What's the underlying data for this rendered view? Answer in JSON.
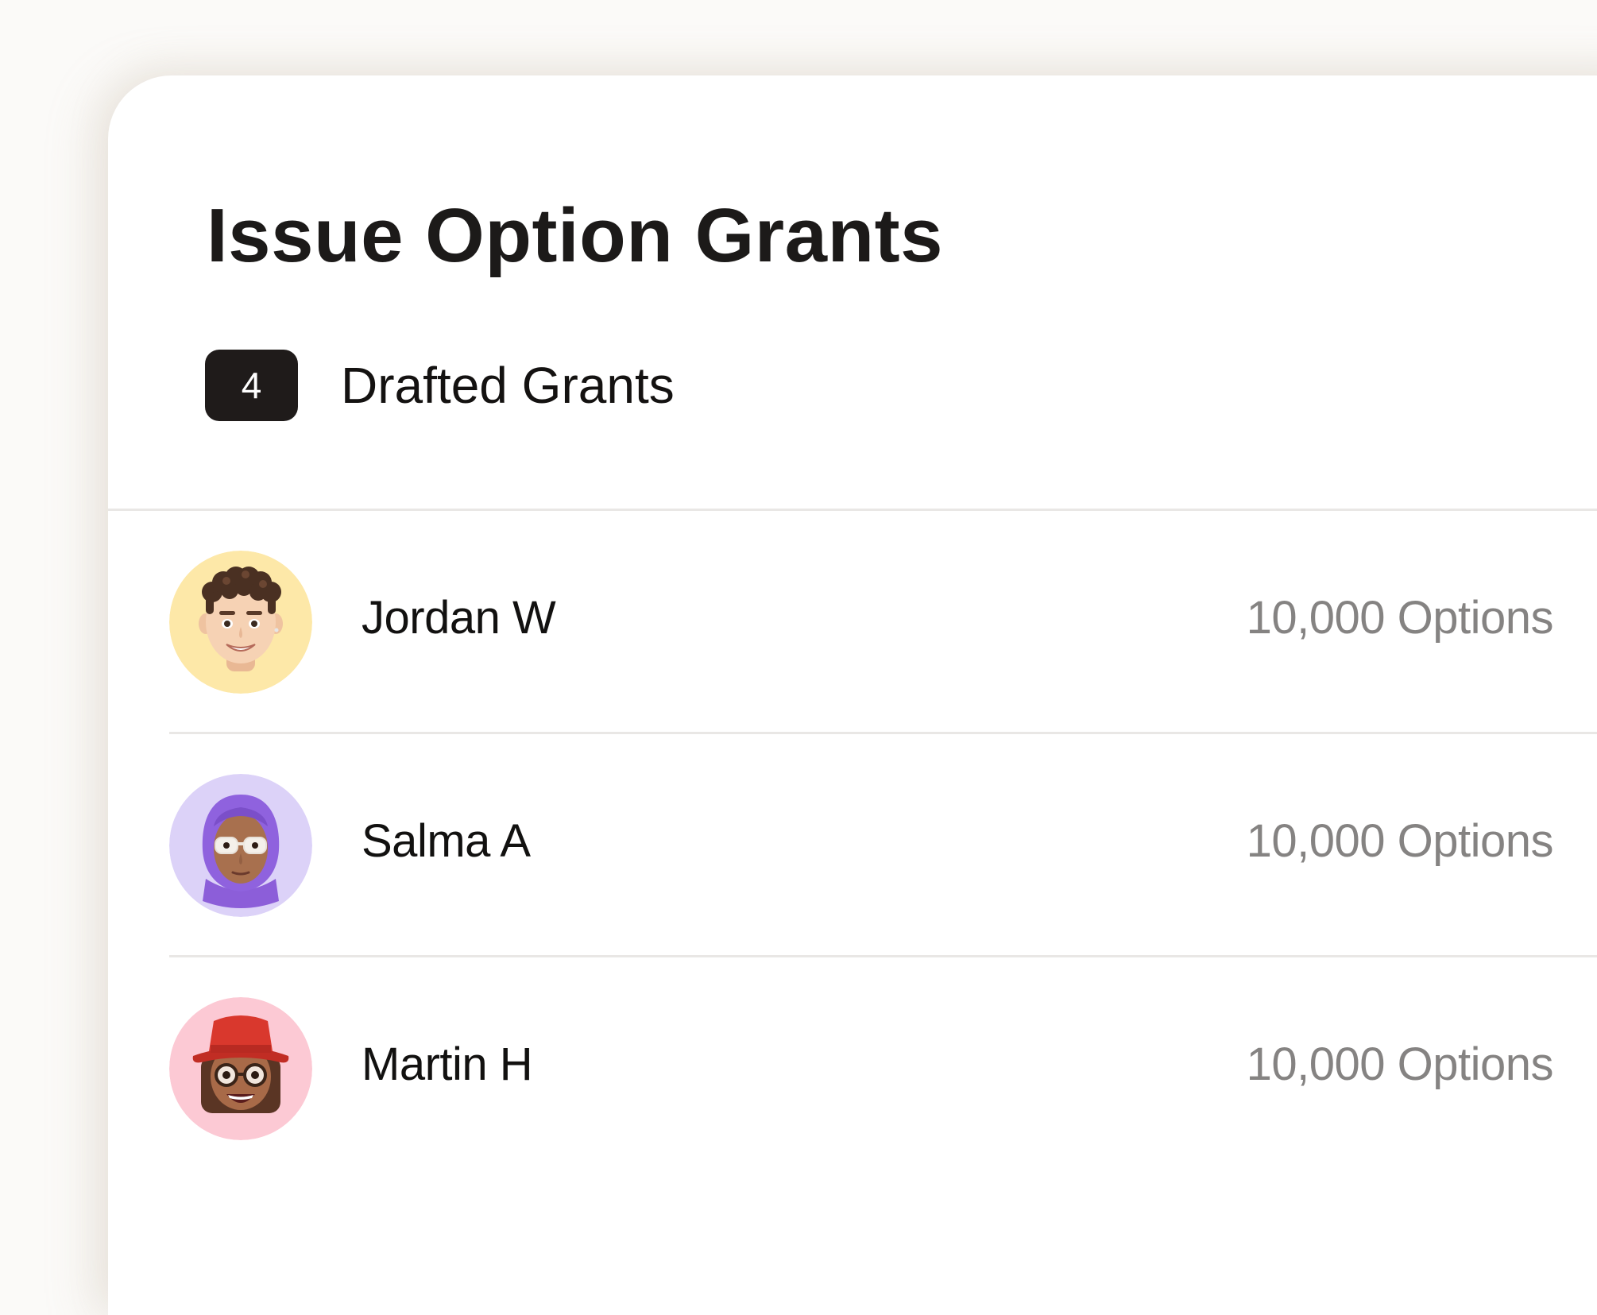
{
  "page": {
    "title": "Issue Option Grants"
  },
  "drafts": {
    "count": "4",
    "label": "Drafted Grants"
  },
  "grants": [
    {
      "name": "Jordan W",
      "amount": "10,000 Options",
      "avatar_icon": "memoji-curly-hair-icon",
      "avatar_color": "#fde8a8"
    },
    {
      "name": "Salma A",
      "amount": "10,000 Options",
      "avatar_icon": "memoji-hijab-glasses-icon",
      "avatar_color": "#dcd2f8"
    },
    {
      "name": "Martin H",
      "amount": "10,000 Options",
      "avatar_icon": "memoji-red-hat-icon",
      "avatar_color": "#fcc9d4"
    }
  ],
  "colors": {
    "background": "#fbfaf8",
    "card": "#ffffff",
    "badge": "#1f1b1a",
    "text_primary": "#121110",
    "text_secondary": "#858382",
    "divider": "#e9e7e5"
  }
}
